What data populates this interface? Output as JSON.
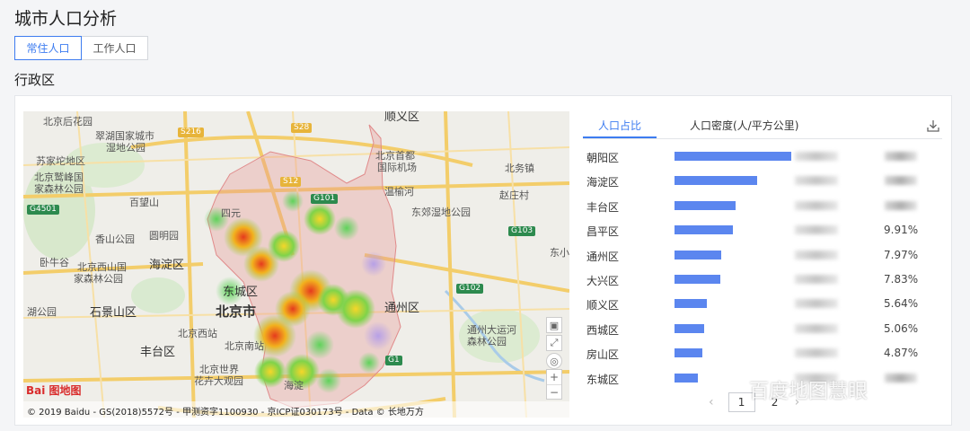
{
  "page": {
    "title": "城市人口分析"
  },
  "tabs": [
    {
      "label": "常住人口",
      "active": true
    },
    {
      "label": "工作人口",
      "active": false
    }
  ],
  "section": {
    "label": "行政区"
  },
  "map": {
    "labels": {
      "l1": "北京后花园",
      "l2": "翠湖国家城市",
      "l3": "湿地公园",
      "l4": "苏家坨地区",
      "l5": "北京鹫峰国",
      "l6": "家森林公园",
      "l7": "百望山",
      "l8": "香山公园",
      "l9": "圆明园",
      "l10": "卧牛谷",
      "l11": "北京西山国",
      "l12": "家森林公园",
      "l13": "海淀区",
      "l14": "东城区",
      "l15": "北京市",
      "l16": "北京西站",
      "l17": "北京南站",
      "l18": "丰台区",
      "l19": "北京世界",
      "l20": "花卉大观园",
      "l21": "石景山区",
      "l22": "湖公园",
      "l23": "顺义区",
      "l24": "北京首都",
      "l25": "国际机场",
      "l26": "温榆河",
      "l27": "东郊湿地公园",
      "l28": "通州区",
      "l29": "通州大运河",
      "l30": "森林公园",
      "l31": "北务镇",
      "l32": "赵庄村",
      "l33": "东小屯",
      "l34": "海淀",
      "l35": "四元"
    },
    "roads": [
      "S28",
      "S216",
      "G4501",
      "S12",
      "G101",
      "G102",
      "G1",
      "G103"
    ],
    "logo": "Bai 图地图",
    "footer": "© 2019 Baidu - GS(2018)5572号 - 甲测资字1100930 - 京ICP证030173号 - Data © 长地万方",
    "zoom": {
      "plus": "+",
      "minus": "−"
    }
  },
  "panel": {
    "tabs": [
      {
        "label": "人口占比",
        "active": true
      },
      {
        "label": "人口密度(人/平方公里)",
        "active": false
      }
    ],
    "rows": [
      {
        "name": "朝阳区",
        "share": 100,
        "pct": ""
      },
      {
        "name": "海淀区",
        "share": 71,
        "pct": ""
      },
      {
        "name": "丰台区",
        "share": 52,
        "pct": ""
      },
      {
        "name": "昌平区",
        "share": 50,
        "pct": "9.91%"
      },
      {
        "name": "通州区",
        "share": 40,
        "pct": "7.97%"
      },
      {
        "name": "大兴区",
        "share": 39,
        "pct": "7.83%"
      },
      {
        "name": "顺义区",
        "share": 28,
        "pct": "5.64%"
      },
      {
        "name": "西城区",
        "share": 25,
        "pct": "5.06%"
      },
      {
        "name": "房山区",
        "share": 24,
        "pct": "4.87%"
      },
      {
        "name": "东城区",
        "share": 20,
        "pct": ""
      }
    ],
    "pager": {
      "prev": "‹",
      "current": "1",
      "next_page": "2",
      "next": "›"
    }
  },
  "watermark": "百度地图慧眼"
}
